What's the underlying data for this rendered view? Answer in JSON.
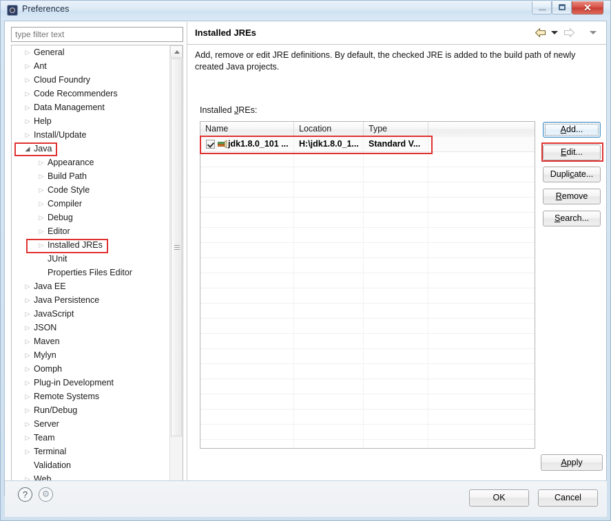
{
  "window": {
    "title": "Preferences",
    "icon": "eclipse-icon",
    "controls": {
      "minimize": "minimize-icon",
      "maximize": "restore-icon",
      "close": "✕"
    }
  },
  "sidebar": {
    "filter": {
      "placeholder": "type filter text",
      "value": ""
    },
    "items": [
      {
        "label": "General",
        "level": 0,
        "twisty": "collapsed",
        "highlight": false
      },
      {
        "label": "Ant",
        "level": 0,
        "twisty": "collapsed",
        "highlight": false
      },
      {
        "label": "Cloud Foundry",
        "level": 0,
        "twisty": "collapsed",
        "highlight": false
      },
      {
        "label": "Code Recommenders",
        "level": 0,
        "twisty": "collapsed",
        "highlight": false
      },
      {
        "label": "Data Management",
        "level": 0,
        "twisty": "collapsed",
        "highlight": false
      },
      {
        "label": "Help",
        "level": 0,
        "twisty": "collapsed",
        "highlight": false
      },
      {
        "label": "Install/Update",
        "level": 0,
        "twisty": "collapsed",
        "highlight": false
      },
      {
        "label": "Java",
        "level": 0,
        "twisty": "expanded",
        "highlight": true
      },
      {
        "label": "Appearance",
        "level": 1,
        "twisty": "collapsed",
        "highlight": false
      },
      {
        "label": "Build Path",
        "level": 1,
        "twisty": "collapsed",
        "highlight": false
      },
      {
        "label": "Code Style",
        "level": 1,
        "twisty": "collapsed",
        "highlight": false
      },
      {
        "label": "Compiler",
        "level": 1,
        "twisty": "collapsed",
        "highlight": false
      },
      {
        "label": "Debug",
        "level": 1,
        "twisty": "collapsed",
        "highlight": false
      },
      {
        "label": "Editor",
        "level": 1,
        "twisty": "collapsed",
        "highlight": false
      },
      {
        "label": "Installed JREs",
        "level": 1,
        "twisty": "collapsed",
        "highlight": true
      },
      {
        "label": "JUnit",
        "level": 1,
        "twisty": "none",
        "highlight": false
      },
      {
        "label": "Properties Files Editor",
        "level": 1,
        "twisty": "none",
        "highlight": false
      },
      {
        "label": "Java EE",
        "level": 0,
        "twisty": "collapsed",
        "highlight": false
      },
      {
        "label": "Java Persistence",
        "level": 0,
        "twisty": "collapsed",
        "highlight": false
      },
      {
        "label": "JavaScript",
        "level": 0,
        "twisty": "collapsed",
        "highlight": false
      },
      {
        "label": "JSON",
        "level": 0,
        "twisty": "collapsed",
        "highlight": false
      },
      {
        "label": "Maven",
        "level": 0,
        "twisty": "collapsed",
        "highlight": false
      },
      {
        "label": "Mylyn",
        "level": 0,
        "twisty": "collapsed",
        "highlight": false
      },
      {
        "label": "Oomph",
        "level": 0,
        "twisty": "collapsed",
        "highlight": false
      },
      {
        "label": "Plug-in Development",
        "level": 0,
        "twisty": "collapsed",
        "highlight": false
      },
      {
        "label": "Remote Systems",
        "level": 0,
        "twisty": "collapsed",
        "highlight": false
      },
      {
        "label": "Run/Debug",
        "level": 0,
        "twisty": "collapsed",
        "highlight": false
      },
      {
        "label": "Server",
        "level": 0,
        "twisty": "collapsed",
        "highlight": false
      },
      {
        "label": "Team",
        "level": 0,
        "twisty": "collapsed",
        "highlight": false
      },
      {
        "label": "Terminal",
        "level": 0,
        "twisty": "collapsed",
        "highlight": false
      },
      {
        "label": "Validation",
        "level": 0,
        "twisty": "none",
        "highlight": false
      },
      {
        "label": "Web",
        "level": 0,
        "twisty": "collapsed",
        "highlight": false
      }
    ],
    "twisty_glyphs": {
      "collapsed": "▷",
      "expanded": "◢",
      "none": ""
    },
    "scrollbar": {
      "up": "▲",
      "down": "▼"
    }
  },
  "page": {
    "title": "Installed JREs",
    "description": "Add, remove or edit JRE definitions. By default, the checked JRE is added to the build path of newly created Java projects.",
    "nav": {
      "back": "back-arrow-icon",
      "back_dropdown": "chevron-down-icon",
      "forward": "forward-arrow-icon",
      "forward_dropdown": "chevron-down-icon",
      "menu": "chevron-down-icon"
    },
    "table_label_prefix": "Installed ",
    "table_label_mnemonic": "J",
    "table_label_suffix": "REs:",
    "table": {
      "columns": [
        "Name",
        "Location",
        "Type",
        ""
      ],
      "rows": [
        {
          "checked": true,
          "icon": "jre-icon",
          "name": "jdk1.8.0_101 ...",
          "location": "H:\\jdk1.8.0_1...",
          "type": "Standard V...",
          "extra": "",
          "bold": true,
          "highlight": true
        }
      ],
      "empty_row_count": 20
    },
    "buttons": [
      {
        "id": "add",
        "pre": "",
        "mnemonic": "A",
        "post": "dd...",
        "focused": true,
        "highlight": false
      },
      {
        "id": "edit",
        "pre": "",
        "mnemonic": "E",
        "post": "dit...",
        "focused": false,
        "highlight": true
      },
      {
        "id": "duplicate",
        "pre": "Dupli",
        "mnemonic": "c",
        "post": "ate...",
        "focused": false,
        "highlight": false
      },
      {
        "id": "remove",
        "pre": "",
        "mnemonic": "R",
        "post": "emove",
        "focused": false,
        "highlight": false
      },
      {
        "id": "search",
        "pre": "",
        "mnemonic": "S",
        "post": "earch...",
        "focused": false,
        "highlight": false
      }
    ],
    "apply": {
      "pre": "",
      "mnemonic": "A",
      "post": "pply"
    }
  },
  "footer": {
    "help_icon": "?",
    "gear_icon": "⚙",
    "ok_label": "OK",
    "cancel_label": "Cancel"
  },
  "colors": {
    "highlight_red": "#e03131",
    "focus_blue": "#4a90c4",
    "title_bar": "#dceaf6"
  }
}
